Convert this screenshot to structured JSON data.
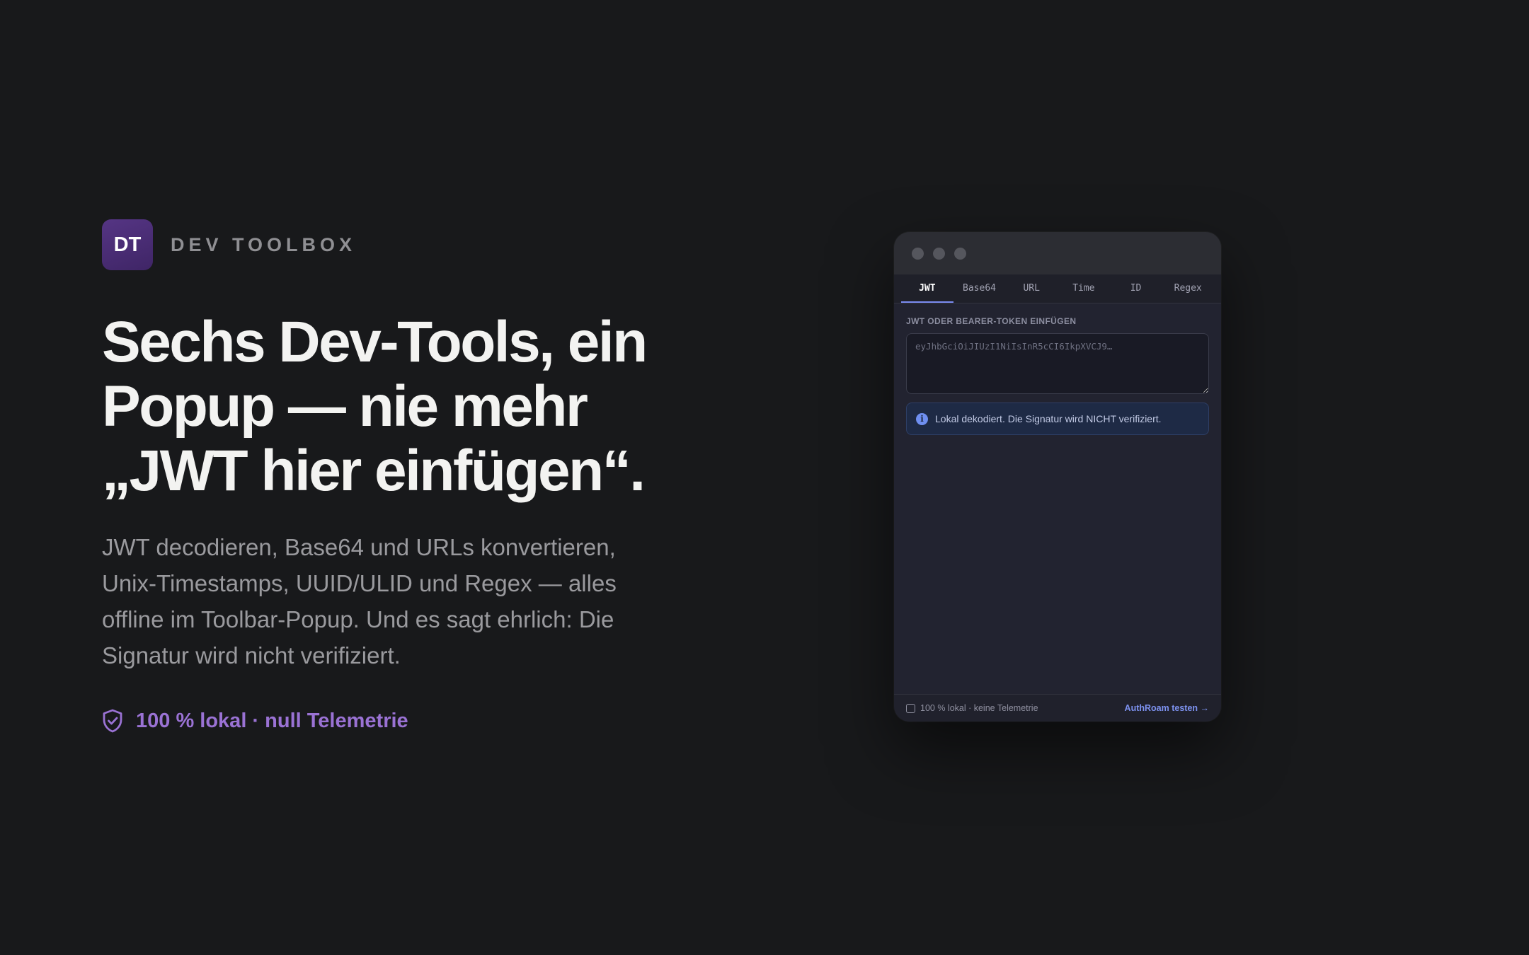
{
  "brand": {
    "logo_text": "DT",
    "name": "DEV TOOLBOX"
  },
  "hero": {
    "headline_lines": [
      "Sechs Dev-Tools, ein",
      "Popup — nie mehr",
      "„JWT hier einfügen“."
    ],
    "lead_lines": [
      "JWT decodieren, Base64 und URLs konvertieren,",
      "Unix-Timestamps, UUID/ULID und Regex — alles",
      "offline im Toolbar-Popup. Und es sagt ehrlich: Die",
      "Signatur wird nicht verifiziert."
    ],
    "trust_icon": "shield-check-icon",
    "trust_text": "100 % lokal · null Telemetrie"
  },
  "popup": {
    "tabs": [
      {
        "label": "JWT",
        "active": true
      },
      {
        "label": "Base64",
        "active": false
      },
      {
        "label": "URL",
        "active": false
      },
      {
        "label": "Time",
        "active": false
      },
      {
        "label": "ID",
        "active": false
      },
      {
        "label": "Regex",
        "active": false
      }
    ],
    "field_label": "JWT ODER BEARER-TOKEN EINFÜGEN",
    "token_placeholder": "eyJhbGciOiJIUzI1NiIsInR5cCI6IkpXVCJ9…",
    "notice_icon": "info-icon",
    "notice_text": "Lokal dekodiert. Die Signatur wird NICHT verifiziert.",
    "footer": {
      "checkbox_label": "100 % lokal · keine Telemetrie",
      "link_label": "AuthRoam testen →"
    }
  },
  "colors": {
    "background": "#18191b",
    "accent_purple": "#9a72d4",
    "accent_blue": "#7d92f0",
    "logo_bg": "#4a2e74"
  }
}
